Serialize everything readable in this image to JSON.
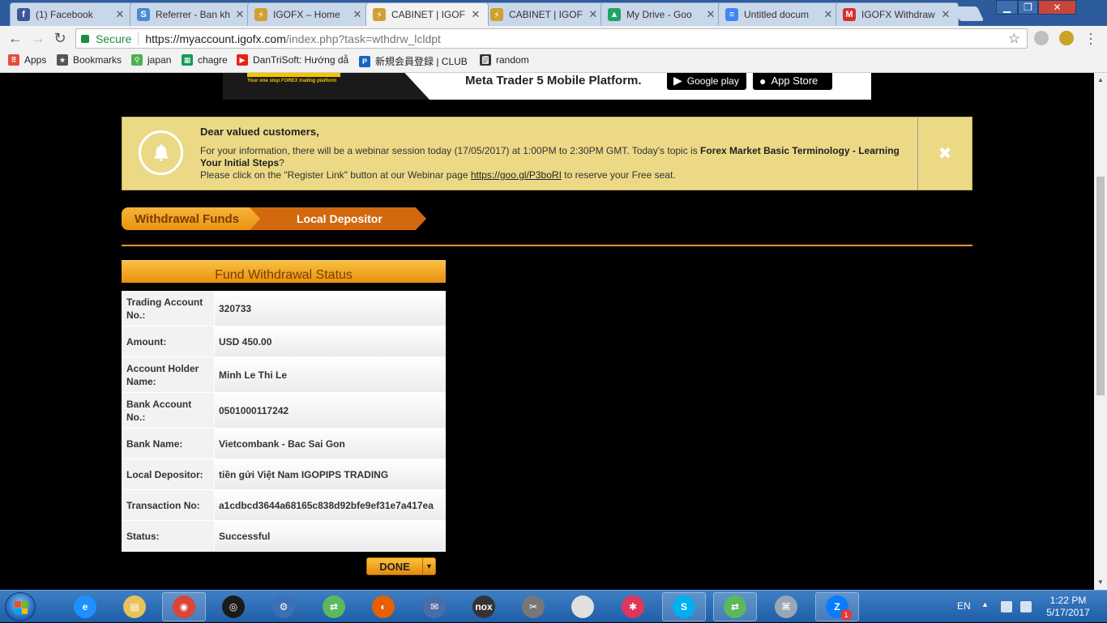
{
  "browser": {
    "tabs": [
      {
        "label": "(1) Facebook",
        "icon": "facebook-icon",
        "color": "#3b5998",
        "glyph": "f"
      },
      {
        "label": "Referrer - Ban kh",
        "icon": "referrer-icon",
        "color": "#4a8bd0",
        "glyph": "S"
      },
      {
        "label": "IGOFX – Home",
        "icon": "igofx-icon",
        "color": "#d0a030",
        "glyph": "⚡"
      },
      {
        "label": "CABINET | IGOF",
        "icon": "igofx-icon",
        "color": "#d0a030",
        "glyph": "⚡",
        "active": true
      },
      {
        "label": "CABINET | IGOF",
        "icon": "igofx-icon",
        "color": "#d0a030",
        "glyph": "⚡"
      },
      {
        "label": "My Drive - Goo",
        "icon": "google-drive-icon",
        "color": "#1fa463",
        "glyph": "▲"
      },
      {
        "label": "Untitled docum",
        "icon": "google-docs-icon",
        "color": "#4285f4",
        "glyph": "≡"
      },
      {
        "label": "IGOFX Withdraw",
        "icon": "gmail-icon",
        "color": "#d93025",
        "glyph": "M"
      }
    ],
    "secure_label": "Secure",
    "url_host": "https://myaccount.igofx.com",
    "url_path": "/index.php?task=wthdrw_lcldpt",
    "bookmarks": [
      {
        "label": "Apps",
        "icon": "apps-icon",
        "color": "#e74c3c",
        "glyph": "⠿"
      },
      {
        "label": "Bookmarks",
        "icon": "star-icon",
        "color": "#555555",
        "glyph": "★"
      },
      {
        "label": "japan",
        "icon": "map-pin-icon",
        "color": "#4caf50",
        "glyph": "⚲"
      },
      {
        "label": "chagre",
        "icon": "spreadsheet-icon",
        "color": "#0f9d58",
        "glyph": "▦"
      },
      {
        "label": "DanTriSoft: Hướng dẫ",
        "icon": "youtube-icon",
        "color": "#e62117",
        "glyph": "▶"
      },
      {
        "label": "新規会員登録 | CLUB",
        "icon": "parking-icon",
        "color": "#1565c0",
        "glyph": "P"
      },
      {
        "label": "random",
        "icon": "random-icon",
        "color": "#333333",
        "glyph": "🗒"
      }
    ]
  },
  "banner": {
    "tagline": "Your one stop FOREX trading platform",
    "platform_text": "Meta Trader 5 Mobile Platform.",
    "google_play": "Google play",
    "app_store": "App Store"
  },
  "notice": {
    "title": "Dear valued customers,",
    "line1_pre": "For your information, there will be a webinar session today (17/05/2017) at 1:00PM to 2:30PM GMT. Today's topic is ",
    "line1_bold": "Forex Market Basic Terminology - Learning Your Initial Steps",
    "line1_post": "?",
    "line2_pre": "Please click on the \"Register Link\" button at our Webinar page ",
    "link": "https://goo.gl/P3boRI",
    "line2_post": " to reserve your Free seat."
  },
  "breadcrumb": {
    "step1": "Withdrawal Funds",
    "step2": "Local Depositor"
  },
  "status": {
    "header": "Fund Withdrawal Status",
    "rows": [
      {
        "key": "Trading Account No.:",
        "value": "320733"
      },
      {
        "key": "Amount:",
        "value": "USD 450.00"
      },
      {
        "key": "Account Holder Name:",
        "value": "Minh Le Thi Le"
      },
      {
        "key": "Bank Account No.:",
        "value": "0501000117242"
      },
      {
        "key": "Bank Name:",
        "value": "Vietcombank - Bac Sai Gon"
      },
      {
        "key": "Local Depositor:",
        "value": "tiền gửi Việt Nam IGOPIPS TRADING"
      },
      {
        "key": "Transaction No:",
        "value": "a1cdbcd3644a68165c838d92bfe9ef31e7a417ea"
      },
      {
        "key": "Status:",
        "value": "Successful"
      }
    ],
    "done_label": "DONE"
  },
  "taskbar": {
    "lang": "EN",
    "time": "1:22 PM",
    "date": "5/17/2017",
    "zalo_badge": "1"
  },
  "colors": {
    "accent_orange": "#e8903a",
    "notice_bg": "#ecd986",
    "secure_green": "#1e8e3e"
  }
}
